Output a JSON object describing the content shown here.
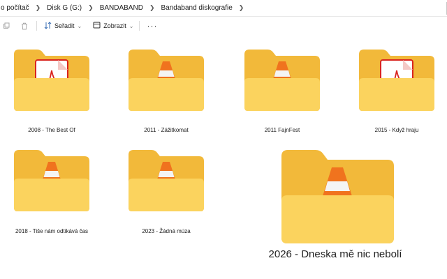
{
  "breadcrumb": [
    "o počítač",
    "Disk G (G:)",
    "BANDABAND",
    "Bandaband diskografie"
  ],
  "toolbar": {
    "sort_label": "Seřadit",
    "view_label": "Zobrazit",
    "more_label": "···"
  },
  "colors": {
    "folder_back": "#f2b93a",
    "folder_front": "#fbd35e",
    "cone_orange": "#f0731e",
    "pdf_red": "#d9241f"
  },
  "folders": [
    {
      "name": "2008 - The Best Of",
      "content_icon": "pdf-document-icon"
    },
    {
      "name": "2011 - Zážitkomat",
      "content_icon": "vlc-cone-icon"
    },
    {
      "name": "2011 FajnFest",
      "content_icon": "vlc-cone-icon"
    },
    {
      "name": "2015 - Když hraju",
      "content_icon": "pdf-document-icon"
    },
    {
      "name": "2018 - Tiše nám odtikává čas",
      "content_icon": "vlc-cone-icon"
    },
    {
      "name": "2023 - Žádná múza",
      "content_icon": "vlc-cone-icon"
    },
    {
      "name": "2026 - Dneska mě nic nebolí",
      "content_icon": "vlc-cone-icon"
    }
  ]
}
